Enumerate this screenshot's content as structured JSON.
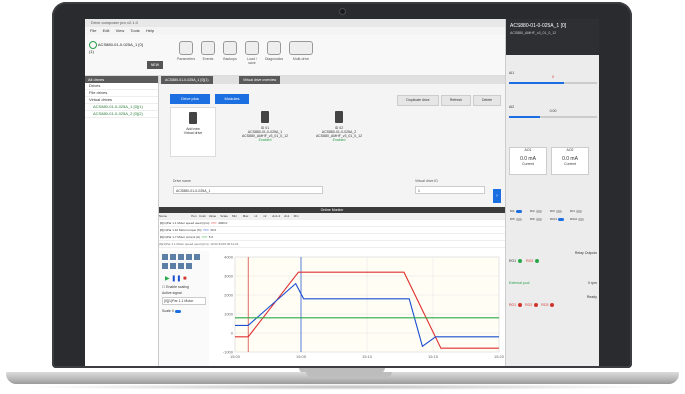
{
  "window": {
    "title": "Drive composer pro v2.1.0"
  },
  "menu": [
    "File",
    "Edit",
    "View",
    "Tools",
    "Help"
  ],
  "ribbon": {
    "drive_chip": "ACS880-01-0-025A_1 [0]",
    "drive_chip_sub": "(1)",
    "new_label": "NEW",
    "buttons": [
      "Parameters",
      "Events",
      "Backups",
      "Load / save",
      "Diagnostics",
      "Multi-drive"
    ]
  },
  "sidebar": {
    "header": "All drives",
    "rows": [
      "Drives",
      "File drives",
      "Virtual drives"
    ],
    "items": [
      "ACS880-01-0-025A_1 [0](1)",
      "ACS880-01-0-025A_2 [0](2)"
    ]
  },
  "tabs": [
    "ACS880-01-0-025A_1 [0](1)",
    "Virtual drive overview"
  ],
  "toolbar": {
    "drive_plus": "Drive plus",
    "modules": "Modules",
    "duplicate": "Duplicate drive",
    "refresh": "Refresh",
    "delete": "Delete"
  },
  "cards": [
    {
      "line1": "Add new",
      "line2": "Virtual drive",
      "status": ""
    },
    {
      "line1": "ID 01",
      "line2": "ACS880-01-0-025A_1",
      "line3": "ACS880_AMHF_v3_01_0_12",
      "status": "Enabled"
    },
    {
      "line1": "ID 02",
      "line2": "ACS880-01-0-025A_2",
      "line3": "ACS880_AMHF_v3_01_0_12",
      "status": "Enabled"
    }
  ],
  "form": {
    "name_label": "Drive name",
    "name_value": "ACS880-01-0-025A_1",
    "id_label": "Virtual drive ID",
    "id_value": "1"
  },
  "monitor": {
    "title": "Online Monitor",
    "columns": [
      "Name",
      "Pen",
      "Color",
      "Value",
      "Scale",
      "Min",
      "Max",
      "x1",
      "x2",
      "Δx1-2",
      "Δx1",
      "Min"
    ],
    "signals": [
      {
        "name": "[0](1)Par 1.1 Motor speed used (rpm)",
        "color": "#e03030",
        "value": "3000.0"
      },
      {
        "name": "[0](1)Par 1.10 Motor torque (%)",
        "color": "#1b4fd0",
        "value": "30.0"
      },
      {
        "name": "[0](1)Par 1.7 Motor current (A)",
        "color": "#2aa84a",
        "value": "5.0"
      }
    ],
    "cursor_note": "[0](1)Par 1.1 Motor speed used (rpm): 12:02:34/15:40:11:22",
    "tool_labels": {
      "enable_scaling": "Enable scaling",
      "active_signal": "Active signal",
      "active_signal_value": "[0](1)Par 1.1 Motor",
      "scale": "Scale X"
    },
    "x_ticks": [
      "15:00",
      "15:05",
      "15:10",
      "15:15",
      "15:20"
    ],
    "y_ticks": [
      "4000",
      "3000",
      "2000",
      "1000",
      "0",
      "-1000"
    ]
  },
  "chart_data": {
    "type": "line",
    "x": [
      "15:00",
      "15:05",
      "15:10",
      "15:15",
      "15:20"
    ],
    "series": [
      {
        "name": "[0](1)Par 1.1 Motor speed used (rpm)",
        "color": "#e03030",
        "points": [
          [
            0,
            -200
          ],
          [
            0.25,
            -200
          ],
          [
            1.2,
            3200
          ],
          [
            3.2,
            3200
          ],
          [
            3.9,
            -800
          ],
          [
            5,
            -800
          ]
        ]
      },
      {
        "name": "[0](1)Par 1.10 Motor torque (%)",
        "color": "#1b4fd0",
        "points": [
          [
            0,
            400
          ],
          [
            0.25,
            400
          ],
          [
            1.15,
            2600
          ],
          [
            1.3,
            1800
          ],
          [
            3.3,
            1800
          ],
          [
            3.55,
            -700
          ],
          [
            3.8,
            -200
          ],
          [
            5,
            -200
          ]
        ]
      },
      {
        "name": "[0](1)Par 1.7 Motor current (A)",
        "color": "#2aa84a",
        "points": [
          [
            0,
            800
          ],
          [
            5,
            800
          ]
        ]
      }
    ],
    "ylim": [
      -1000,
      4000
    ],
    "xlim": [
      0,
      5
    ]
  },
  "right_panel": {
    "title": "ACS880-01-0-025A_1 [0]",
    "subtitle": "ACS880_AMHF_v3_01_0_12",
    "speed_ref_label": "AI1",
    "speed_ref_value": "0",
    "speed_ref_fill": 0.62,
    "slider2_label": "AI2",
    "slider2_value": "0.00",
    "slider2_fill": 0.35,
    "gauge1_label": "AO1",
    "gauge1_value": "0.0",
    "gauge1_unit": "mA",
    "gauge2_label": "AO2",
    "gauge2_value": "0.0",
    "gauge2_unit": "mA",
    "gauge_caption": "Current",
    "digital_inputs": [
      "DI1",
      "DI2",
      "DI3",
      "DI4",
      "DI5",
      "DI6",
      "DIO1",
      "DIO2"
    ],
    "di_on": [
      true,
      false,
      false,
      false,
      false,
      false,
      true,
      false
    ],
    "relay_label": "Relay Outputs",
    "relays": [
      "RO1",
      "RO2",
      "RO3"
    ],
    "external_label": "External pool",
    "external_value": "0",
    "external_unit": "rpm",
    "outputs": [
      "RO1",
      "RO2",
      "RO3"
    ],
    "ready_label": "Ready"
  }
}
